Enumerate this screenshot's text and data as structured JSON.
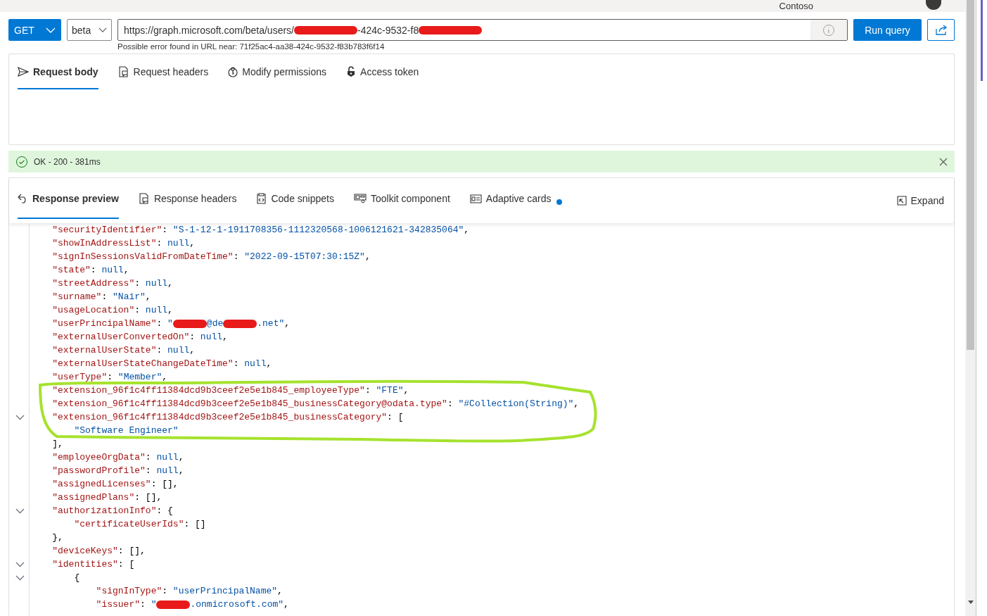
{
  "top_bar": {
    "tenant": "Contoso"
  },
  "query_bar": {
    "method": "GET",
    "version": "beta",
    "url": [
      {
        "kind": "text",
        "text": "https://graph.microsoft.com/beta/users/"
      },
      {
        "kind": "redacted"
      },
      {
        "kind": "text",
        "text": "-424c-9532-f8"
      },
      {
        "kind": "redacted"
      }
    ],
    "hint": "Possible error found in URL near: 71f25ac4-aa38-424c-9532-f83b783f6f14",
    "run_button": "Run query"
  },
  "request_tabs": [
    {
      "label": "Request body",
      "selected": true
    },
    {
      "label": "Request headers",
      "selected": false
    },
    {
      "label": "Modify permissions",
      "selected": false
    },
    {
      "label": "Access token",
      "selected": false
    }
  ],
  "status": {
    "text": "OK - 200 - 381ms"
  },
  "response_tabs": [
    {
      "label": "Response preview",
      "selected": true,
      "notification": false
    },
    {
      "label": "Response headers",
      "selected": false,
      "notification": false
    },
    {
      "label": "Code snippets",
      "selected": false,
      "notification": false
    },
    {
      "label": "Toolkit component",
      "selected": false,
      "notification": false
    },
    {
      "label": "Adaptive cards",
      "selected": false,
      "notification": true
    }
  ],
  "expand_button": "Expand",
  "code_lines": [
    {
      "foldable": false,
      "tokens": [
        {
          "kind": "key",
          "text": "    \"securityIdentifier\""
        },
        {
          "kind": "punct",
          "text": ": "
        },
        {
          "kind": "str",
          "text": "\"S-1-12-1-1911708356-1112320568-1006121621-342835064\""
        },
        {
          "kind": "punct",
          "text": ","
        }
      ]
    },
    {
      "foldable": false,
      "tokens": [
        {
          "kind": "key",
          "text": "    \"showInAddressList\""
        },
        {
          "kind": "punct",
          "text": ": "
        },
        {
          "kind": "str",
          "text": "null"
        },
        {
          "kind": "punct",
          "text": ","
        }
      ]
    },
    {
      "foldable": false,
      "tokens": [
        {
          "kind": "key",
          "text": "    \"signInSessionsValidFromDateTime\""
        },
        {
          "kind": "punct",
          "text": ": "
        },
        {
          "kind": "str",
          "text": "\"2022-09-15T07:30:15Z\""
        },
        {
          "kind": "punct",
          "text": ","
        }
      ]
    },
    {
      "foldable": false,
      "tokens": [
        {
          "kind": "key",
          "text": "    \"state\""
        },
        {
          "kind": "punct",
          "text": ": "
        },
        {
          "kind": "str",
          "text": "null"
        },
        {
          "kind": "punct",
          "text": ","
        }
      ]
    },
    {
      "foldable": false,
      "tokens": [
        {
          "kind": "key",
          "text": "    \"streetAddress\""
        },
        {
          "kind": "punct",
          "text": ": "
        },
        {
          "kind": "str",
          "text": "null"
        },
        {
          "kind": "punct",
          "text": ","
        }
      ]
    },
    {
      "foldable": false,
      "tokens": [
        {
          "kind": "key",
          "text": "    \"surname\""
        },
        {
          "kind": "punct",
          "text": ": "
        },
        {
          "kind": "str",
          "text": "\"Nair\""
        },
        {
          "kind": "punct",
          "text": ","
        }
      ]
    },
    {
      "foldable": false,
      "tokens": [
        {
          "kind": "key",
          "text": "    \"usageLocation\""
        },
        {
          "kind": "punct",
          "text": ": "
        },
        {
          "kind": "str",
          "text": "null"
        },
        {
          "kind": "punct",
          "text": ","
        }
      ]
    },
    {
      "foldable": false,
      "tokens": [
        {
          "kind": "key",
          "text": "    \"userPrincipalName\""
        },
        {
          "kind": "punct",
          "text": ": "
        },
        {
          "kind": "str",
          "text": "\""
        },
        {
          "kind": "redacted"
        },
        {
          "kind": "str",
          "text": "@de"
        },
        {
          "kind": "redacted"
        },
        {
          "kind": "str",
          "text": ".net\""
        },
        {
          "kind": "punct",
          "text": ","
        }
      ]
    },
    {
      "foldable": false,
      "tokens": [
        {
          "kind": "key",
          "text": "    \"externalUserConvertedOn\""
        },
        {
          "kind": "punct",
          "text": ": "
        },
        {
          "kind": "str",
          "text": "null"
        },
        {
          "kind": "punct",
          "text": ","
        }
      ]
    },
    {
      "foldable": false,
      "tokens": [
        {
          "kind": "key",
          "text": "    \"externalUserState\""
        },
        {
          "kind": "punct",
          "text": ": "
        },
        {
          "kind": "str",
          "text": "null"
        },
        {
          "kind": "punct",
          "text": ","
        }
      ]
    },
    {
      "foldable": false,
      "tokens": [
        {
          "kind": "key",
          "text": "    \"externalUserStateChangeDateTime\""
        },
        {
          "kind": "punct",
          "text": ": "
        },
        {
          "kind": "str",
          "text": "null"
        },
        {
          "kind": "punct",
          "text": ","
        }
      ]
    },
    {
      "foldable": false,
      "tokens": [
        {
          "kind": "key",
          "text": "    \"userType\""
        },
        {
          "kind": "punct",
          "text": ": "
        },
        {
          "kind": "str",
          "text": "\"Member\""
        },
        {
          "kind": "punct",
          "text": ","
        }
      ]
    },
    {
      "foldable": false,
      "tokens": [
        {
          "kind": "key",
          "text": "    \"extension_96f1c4ff11384dcd9b3ceef2e5e1b845_employeeType\""
        },
        {
          "kind": "punct",
          "text": ": "
        },
        {
          "kind": "str",
          "text": "\"FTE\""
        },
        {
          "kind": "punct",
          "text": ","
        }
      ]
    },
    {
      "foldable": false,
      "tokens": [
        {
          "kind": "key",
          "text": "    \"extension_96f1c4ff11384dcd9b3ceef2e5e1b845_businessCategory@odata.type\""
        },
        {
          "kind": "punct",
          "text": ": "
        },
        {
          "kind": "str",
          "text": "\"#Collection(String)\""
        },
        {
          "kind": "punct",
          "text": ","
        }
      ]
    },
    {
      "foldable": true,
      "tokens": [
        {
          "kind": "key",
          "text": "    \"extension_96f1c4ff11384dcd9b3ceef2e5e1b845_businessCategory\""
        },
        {
          "kind": "punct",
          "text": ": ["
        }
      ]
    },
    {
      "foldable": false,
      "tokens": [
        {
          "kind": "str",
          "text": "        \"Software Engineer\""
        }
      ]
    },
    {
      "foldable": false,
      "tokens": [
        {
          "kind": "punct",
          "text": "    ],"
        }
      ]
    },
    {
      "foldable": false,
      "tokens": [
        {
          "kind": "key",
          "text": "    \"employeeOrgData\""
        },
        {
          "kind": "punct",
          "text": ": "
        },
        {
          "kind": "str",
          "text": "null"
        },
        {
          "kind": "punct",
          "text": ","
        }
      ]
    },
    {
      "foldable": false,
      "tokens": [
        {
          "kind": "key",
          "text": "    \"passwordProfile\""
        },
        {
          "kind": "punct",
          "text": ": "
        },
        {
          "kind": "str",
          "text": "null"
        },
        {
          "kind": "punct",
          "text": ","
        }
      ]
    },
    {
      "foldable": false,
      "tokens": [
        {
          "kind": "key",
          "text": "    \"assignedLicenses\""
        },
        {
          "kind": "punct",
          "text": ": [],"
        }
      ]
    },
    {
      "foldable": false,
      "tokens": [
        {
          "kind": "key",
          "text": "    \"assignedPlans\""
        },
        {
          "kind": "punct",
          "text": ": [],"
        }
      ]
    },
    {
      "foldable": true,
      "tokens": [
        {
          "kind": "key",
          "text": "    \"authorizationInfo\""
        },
        {
          "kind": "punct",
          "text": ": {"
        }
      ]
    },
    {
      "foldable": false,
      "tokens": [
        {
          "kind": "key",
          "text": "        \"certificateUserIds\""
        },
        {
          "kind": "punct",
          "text": ": []"
        }
      ]
    },
    {
      "foldable": false,
      "tokens": [
        {
          "kind": "punct",
          "text": "    },"
        }
      ]
    },
    {
      "foldable": false,
      "tokens": [
        {
          "kind": "key",
          "text": "    \"deviceKeys\""
        },
        {
          "kind": "punct",
          "text": ": [],"
        }
      ]
    },
    {
      "foldable": true,
      "tokens": [
        {
          "kind": "key",
          "text": "    \"identities\""
        },
        {
          "kind": "punct",
          "text": ": ["
        }
      ]
    },
    {
      "foldable": true,
      "tokens": [
        {
          "kind": "punct",
          "text": "        {"
        }
      ]
    },
    {
      "foldable": false,
      "tokens": [
        {
          "kind": "key",
          "text": "            \"signInType\""
        },
        {
          "kind": "punct",
          "text": ": "
        },
        {
          "kind": "str",
          "text": "\"userPrincipalName\""
        },
        {
          "kind": "punct",
          "text": ","
        }
      ]
    },
    {
      "foldable": false,
      "tokens": [
        {
          "kind": "key",
          "text": "            \"issuer\""
        },
        {
          "kind": "punct",
          "text": ": "
        },
        {
          "kind": "str",
          "text": "\""
        },
        {
          "kind": "redacted"
        },
        {
          "kind": "str",
          "text": ".onmicrosoft.com\""
        },
        {
          "kind": "punct",
          "text": ","
        }
      ]
    }
  ]
}
